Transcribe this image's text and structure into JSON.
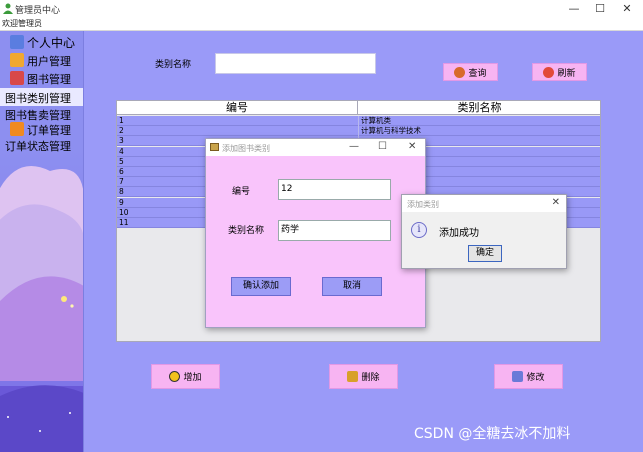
{
  "window": {
    "title": "管理员中心"
  },
  "menubar": {
    "welcome": "欢迎管理员"
  },
  "sidebar": {
    "items": [
      {
        "label": "个人中心",
        "icon": "person-icon"
      },
      {
        "label": "用户管理",
        "icon": "users-icon"
      },
      {
        "label": "图书管理",
        "icon": "books-icon"
      },
      {
        "label": "图书类别管理",
        "icon": ""
      },
      {
        "label": "图书售卖管理",
        "icon": ""
      },
      {
        "label": "订单管理",
        "icon": "order-icon"
      },
      {
        "label": "订单状态管理",
        "icon": ""
      }
    ],
    "active_index": 3
  },
  "search": {
    "label": "类别名称",
    "value": ""
  },
  "toolbar": {
    "query_label": "查询",
    "refresh_label": "刷新"
  },
  "table": {
    "headers": [
      "编号",
      "类别名称"
    ],
    "rows": [
      [
        "1",
        "计算机类"
      ],
      [
        "2",
        "计算机与科学技术"
      ],
      [
        "3",
        ""
      ],
      [
        "4",
        ""
      ],
      [
        "5",
        ""
      ],
      [
        "6",
        ""
      ],
      [
        "7",
        ""
      ],
      [
        "8",
        ""
      ],
      [
        "9",
        ""
      ],
      [
        "10",
        ""
      ],
      [
        "11",
        ""
      ]
    ]
  },
  "actions": {
    "add_label": "增加",
    "delete_label": "删除",
    "edit_label": "修改"
  },
  "add_dialog": {
    "title": "添加图书类别",
    "id_label": "编号",
    "id_value": "12",
    "name_label": "类别名称",
    "name_value": "药学",
    "confirm_label": "确认添加",
    "cancel_label": "取消"
  },
  "message_dialog": {
    "title": "添加类别",
    "text": "添加成功",
    "ok_label": "确定"
  },
  "watermark": "CSDN @全糖去冰不加料",
  "colors": {
    "background": "#9a9af8",
    "sidebar": "#8d8ff0",
    "pink_button": "#f7b4f2",
    "dialog": "#f9c4fb",
    "blue_button": "#9c9cf6"
  }
}
